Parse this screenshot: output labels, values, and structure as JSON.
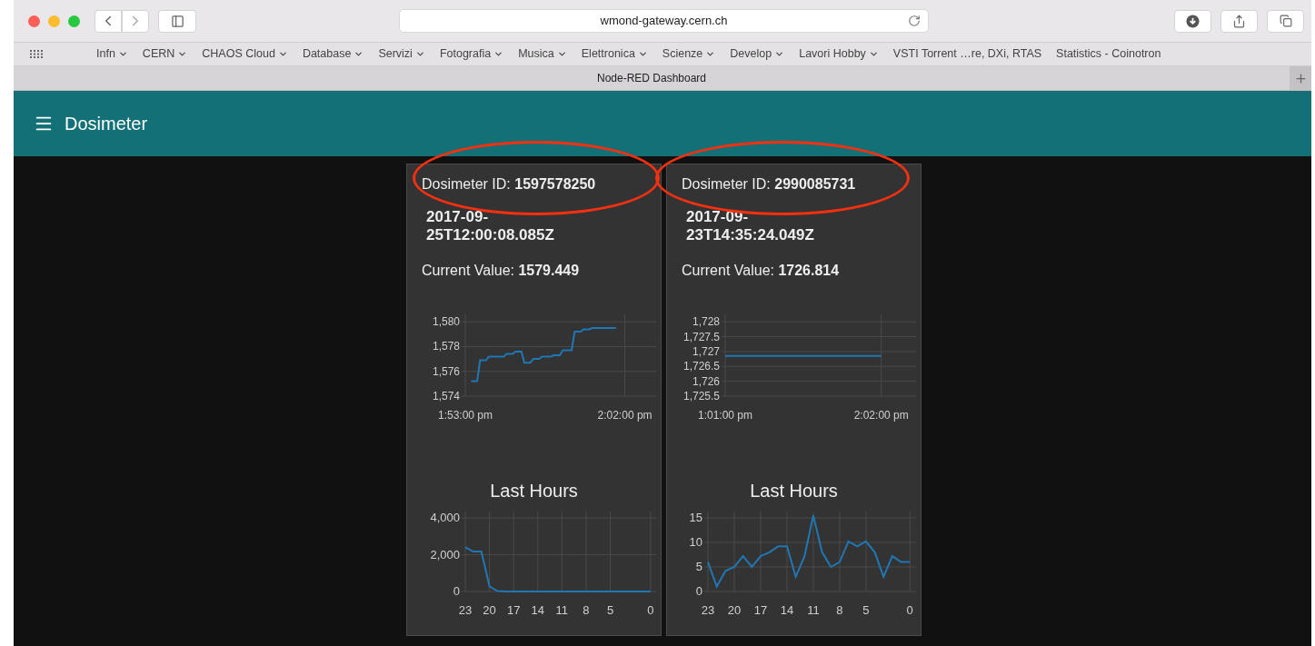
{
  "browser": {
    "url": "wmond-gateway.cern.ch",
    "tab_title": "Node-RED Dashboard",
    "bookmarks": [
      {
        "label": "Infn",
        "dropdown": true
      },
      {
        "label": "CERN",
        "dropdown": true
      },
      {
        "label": "CHAOS Cloud",
        "dropdown": true
      },
      {
        "label": "Database",
        "dropdown": true
      },
      {
        "label": "Servizi",
        "dropdown": true
      },
      {
        "label": "Fotografia",
        "dropdown": true
      },
      {
        "label": "Musica",
        "dropdown": true
      },
      {
        "label": "Elettronica",
        "dropdown": true
      },
      {
        "label": "Scienze",
        "dropdown": true
      },
      {
        "label": "Develop",
        "dropdown": true
      },
      {
        "label": "Lavori Hobby",
        "dropdown": true
      },
      {
        "label": "VSTI Torrent …re, DXi, RTAS",
        "dropdown": false
      },
      {
        "label": "Statistics - Coinotron",
        "dropdown": false
      }
    ]
  },
  "header": {
    "title": "Dosimeter"
  },
  "cards": [
    {
      "id_text": "Dosimeter ID: **1597578250**",
      "highlighted": true,
      "timestamp": "2017-09-25T12:00:08.085Z",
      "current_value": "Current Value: **1579.449**",
      "trend_chart": {
        "chart_data": {
          "type": "line",
          "categories": [
            "1:53:00 pm",
            null,
            null,
            null,
            null,
            null,
            null,
            null,
            null,
            null,
            null,
            null,
            null,
            null,
            null,
            null,
            null,
            null,
            null,
            null,
            null,
            null,
            null,
            null,
            null,
            null,
            null,
            null,
            null,
            null,
            null,
            null,
            null,
            null,
            null,
            null,
            null,
            null,
            null,
            null,
            null,
            null,
            null,
            null,
            null,
            null,
            null,
            null,
            null,
            null,
            null,
            null,
            null,
            null,
            "2:02:00 pm",
            null,
            null,
            null,
            null,
            null,
            null,
            null,
            null,
            null,
            null
          ],
          "values": [
            null,
            null,
            1575.2,
            1575.2,
            1575.2,
            1576.9,
            1576.9,
            1576.9,
            1577.2,
            1577.2,
            1577.2,
            1577.2,
            1577.2,
            1577.2,
            1577.4,
            1577.4,
            1577.4,
            1577.6,
            1577.6,
            1577.6,
            1576.7,
            1576.7,
            1576.7,
            1577.0,
            1577.0,
            1577.0,
            1577.2,
            1577.2,
            1577.2,
            1577.2,
            1577.3,
            1577.3,
            1577.3,
            1577.7,
            1577.7,
            1577.7,
            1577.7,
            1579.2,
            1579.2,
            1579.2,
            1579.4,
            1579.4,
            1579.4,
            1579.5,
            1579.5,
            1579.5,
            1579.5,
            1579.5,
            1579.5,
            1579.5,
            1579.5,
            1579.5,
            null,
            null,
            null,
            null,
            null,
            null,
            null,
            null,
            null,
            null,
            null,
            null,
            null
          ],
          "ylim": [
            1574,
            1580.6
          ],
          "grid": true,
          "yticks": [
            {
              "value": 1574,
              "label": "1,574"
            },
            {
              "value": 1576,
              "label": "1,576"
            },
            {
              "value": 1578,
              "label": "1,578"
            },
            {
              "value": 1580,
              "label": "1,580"
            }
          ]
        }
      },
      "history_chart": {
        "chart_data": {
          "type": "line",
          "title": "Last Hours",
          "x": [
            23,
            22,
            21,
            20,
            19,
            18,
            17,
            16,
            15,
            14,
            13,
            12,
            11,
            10,
            9,
            8,
            7,
            6,
            5,
            4,
            3,
            2,
            1,
            0
          ],
          "values": [
            2400,
            2170,
            2170,
            280,
            20,
            0,
            0,
            0,
            0,
            0,
            0,
            0,
            0,
            0,
            0,
            0,
            0,
            0,
            0,
            0,
            0,
            0,
            0,
            0
          ],
          "xlim": [
            23,
            -0.7
          ],
          "ylim": [
            0,
            4350
          ],
          "grid": true,
          "xticks": [
            23,
            20,
            17,
            14,
            11,
            8,
            5,
            0
          ],
          "yticks": [
            {
              "value": 0,
              "label": "0"
            },
            {
              "value": 2000,
              "label": "2,000"
            },
            {
              "value": 4000,
              "label": "4,000"
            }
          ]
        }
      }
    },
    {
      "id_text": "Dosimeter ID: **2990085731**",
      "highlighted": true,
      "timestamp": "2017-09-23T14:35:24.049Z",
      "current_value": "Current Value: **1726.814**",
      "trend_chart": {
        "chart_data": {
          "type": "line",
          "categories": [
            "1:01:00 pm",
            null,
            null,
            null,
            null,
            null,
            null,
            null,
            null,
            null,
            null,
            null,
            null,
            null,
            null,
            null,
            null,
            null,
            null,
            null,
            null,
            null,
            null,
            null,
            null,
            null,
            null,
            null,
            null,
            null,
            null,
            null,
            null,
            null,
            null,
            null,
            null,
            null,
            null,
            null,
            null,
            null,
            null,
            null,
            null,
            null,
            null,
            null,
            null,
            null,
            null,
            null,
            null,
            null,
            null,
            null,
            null,
            null,
            null,
            null,
            null,
            "2:02:00 pm",
            null,
            null,
            null,
            null,
            null,
            null,
            null,
            null,
            null,
            null,
            null,
            null,
            null
          ],
          "values": [
            1726.85,
            1726.85,
            1726.85,
            1726.85,
            1726.85,
            1726.85,
            1726.85,
            1726.85,
            1726.85,
            1726.85,
            1726.85,
            1726.85,
            1726.85,
            1726.85,
            1726.85,
            1726.85,
            1726.85,
            1726.85,
            1726.85,
            1726.85,
            1726.85,
            1726.85,
            1726.85,
            1726.85,
            1726.85,
            1726.85,
            1726.85,
            1726.85,
            1726.85,
            1726.85,
            1726.85,
            1726.85,
            1726.85,
            1726.85,
            1726.85,
            1726.85,
            1726.85,
            1726.85,
            1726.85,
            1726.85,
            1726.85,
            1726.85,
            1726.85,
            1726.85,
            1726.85,
            1726.85,
            1726.85,
            1726.85,
            1726.85,
            1726.85,
            1726.85,
            1726.85,
            1726.85,
            1726.85,
            1726.85,
            1726.85,
            1726.85,
            1726.85,
            1726.85,
            1726.85,
            1726.85,
            1726.85,
            null,
            null,
            null,
            null,
            null,
            null,
            null,
            null,
            null,
            null,
            null,
            null,
            null
          ],
          "ylim": [
            1725.5,
            1728.25
          ],
          "grid": true,
          "yticks": [
            {
              "value": 1725.5,
              "label": "1,725.5"
            },
            {
              "value": 1726,
              "label": "1,726"
            },
            {
              "value": 1726.5,
              "label": "1,726.5"
            },
            {
              "value": 1727,
              "label": "1,727"
            },
            {
              "value": 1727.5,
              "label": "1,727.5"
            },
            {
              "value": 1728,
              "label": "1,728"
            }
          ]
        }
      },
      "history_chart": {
        "chart_data": {
          "type": "line",
          "title": "Last Hours",
          "x": [
            23,
            22,
            21,
            20,
            19,
            18,
            17,
            16,
            15,
            14,
            13,
            12,
            11,
            10,
            9,
            8,
            7,
            6,
            5,
            4,
            3,
            2,
            1,
            0
          ],
          "values": [
            6,
            1,
            4.2,
            5,
            7.2,
            5,
            7.2,
            8,
            9.2,
            9.2,
            3,
            7.2,
            15.5,
            8,
            5,
            6,
            10.2,
            9.2,
            10.2,
            8,
            3,
            7.2,
            6,
            6
          ],
          "xlim": [
            23,
            -0.7
          ],
          "ylim": [
            0,
            16.3
          ],
          "grid": true,
          "xticks": [
            23,
            20,
            17,
            14,
            11,
            8,
            5,
            0
          ],
          "yticks": [
            0,
            5,
            10,
            15
          ]
        }
      }
    }
  ]
}
